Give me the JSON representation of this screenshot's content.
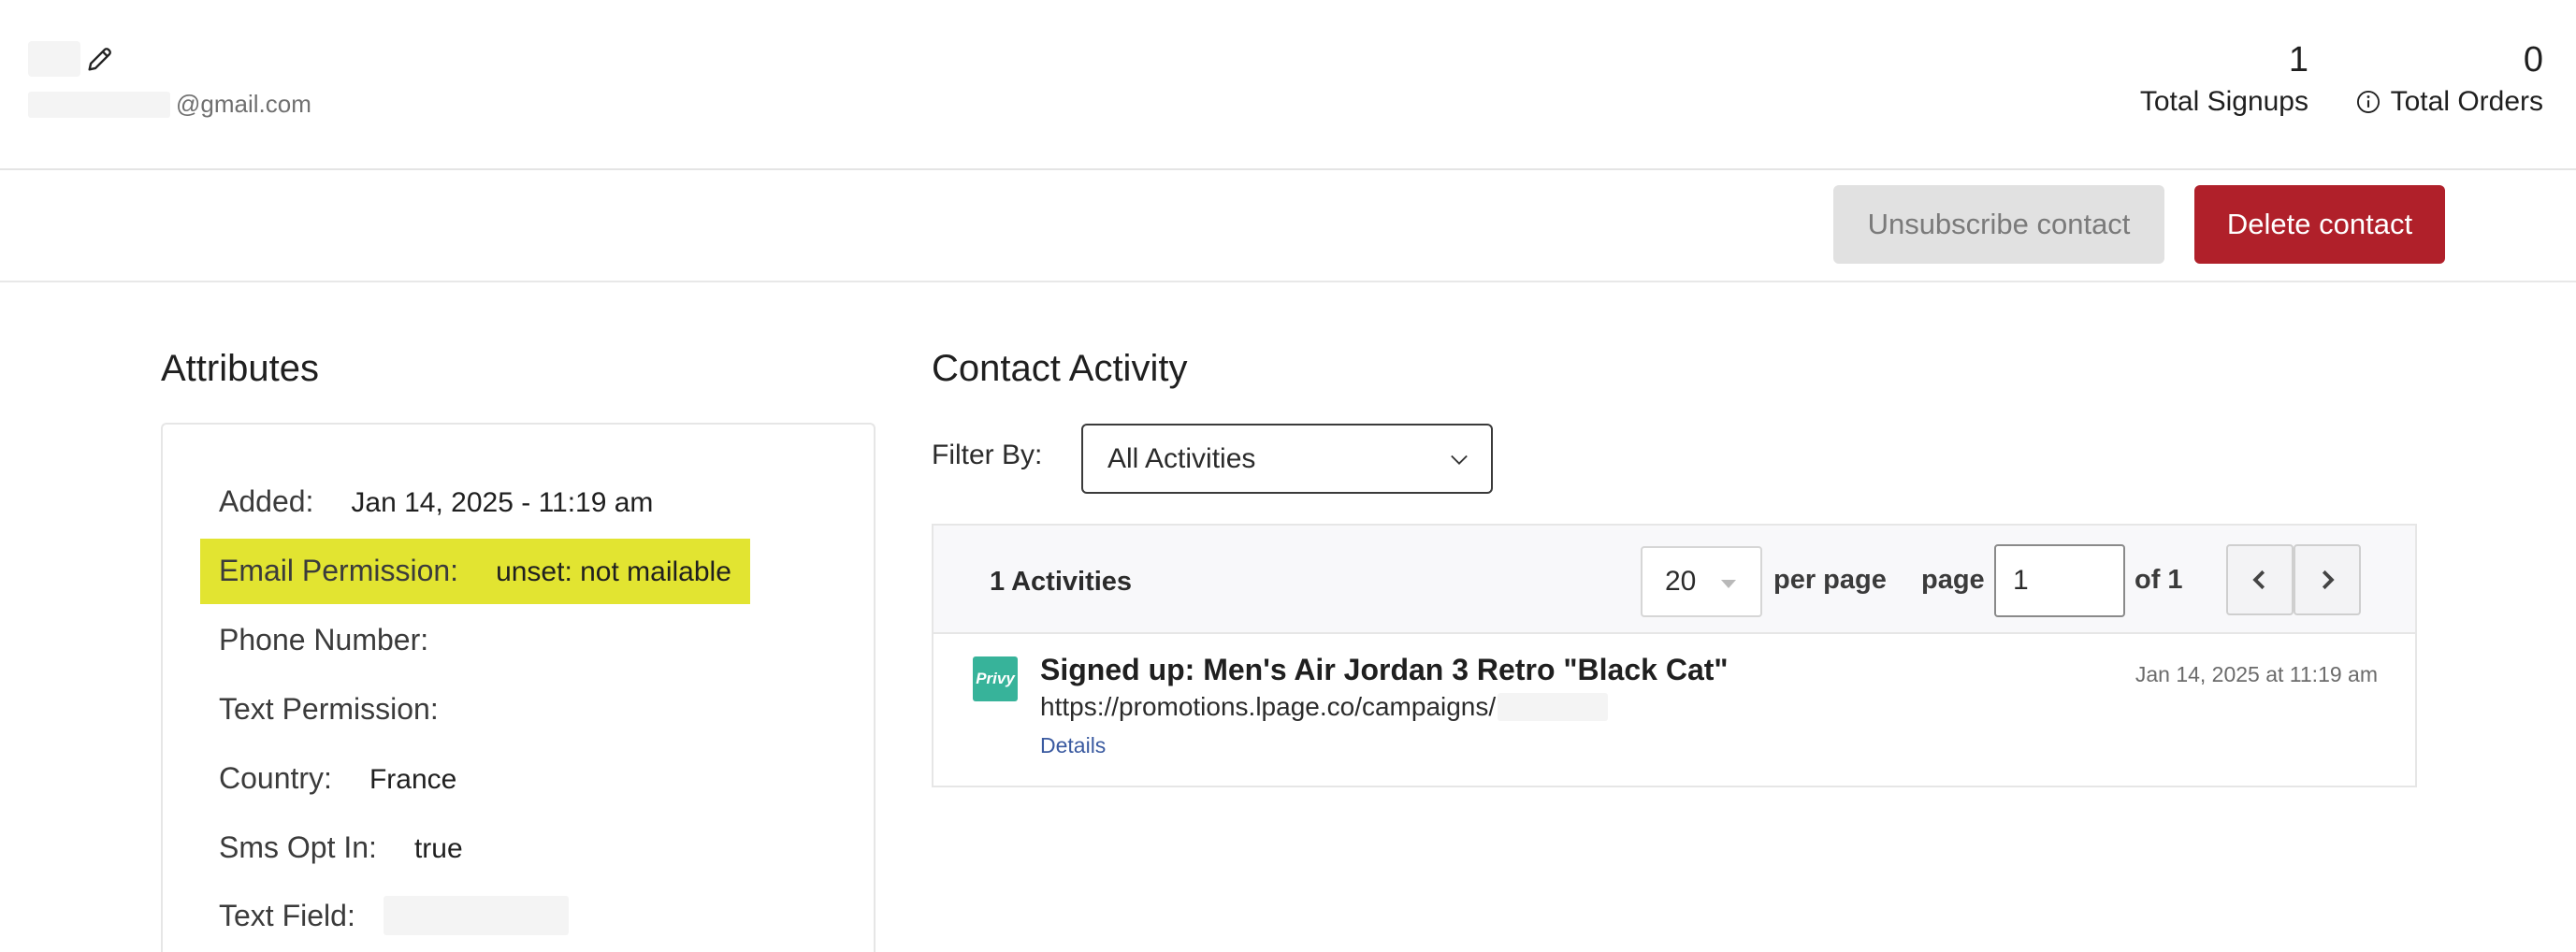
{
  "header": {
    "email_domain": "@gmail.com",
    "stats": [
      {
        "value": "1",
        "label": "Total Signups"
      },
      {
        "value": "0",
        "label": "Total Orders"
      }
    ]
  },
  "actions": {
    "unsubscribe_label": "Unsubscribe contact",
    "delete_label": "Delete contact",
    "delete_color": "#b0202a"
  },
  "attributes": {
    "title": "Attributes",
    "highlight_color": "#e2e431",
    "rows": [
      {
        "key": "Added:",
        "value": "Jan 14, 2025 - 11:19 am"
      },
      {
        "key": "Email Permission:",
        "value": "unset: not mailable"
      },
      {
        "key": "Phone Number:",
        "value": ""
      },
      {
        "key": "Text Permission:",
        "value": ""
      },
      {
        "key": "Country:",
        "value": "France"
      },
      {
        "key": "Sms Opt In:",
        "value": "true"
      },
      {
        "key": "Text Field:",
        "value": ""
      }
    ]
  },
  "activity": {
    "title": "Contact Activity",
    "filter_label": "Filter By:",
    "filter_value": "All Activities",
    "count_label": "1 Activities",
    "per_page_value": "20",
    "per_page_label": "per page",
    "page_label": "page",
    "page_value": "1",
    "of_label": "of 1",
    "items": [
      {
        "logo_text": "Privy",
        "logo_color": "#37b39a",
        "headline": "Signed up: Men's Air Jordan 3 Retro \"Black Cat\"",
        "url": "https://promotions.lpage.co/campaigns/",
        "details_label": "Details",
        "timestamp": "Jan 14, 2025 at 11:19 am"
      }
    ]
  }
}
